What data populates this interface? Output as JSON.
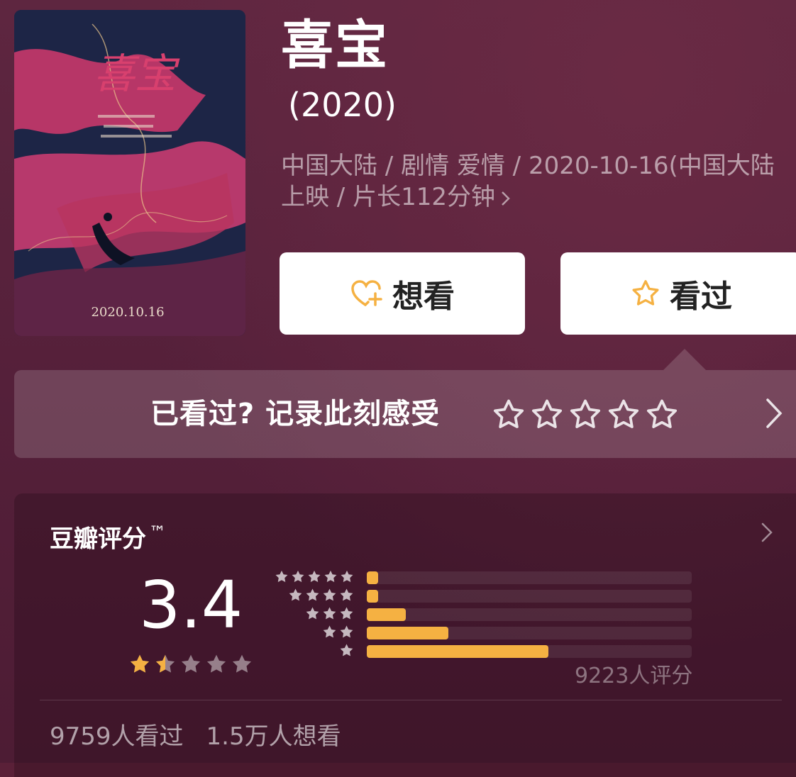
{
  "movie": {
    "title": "喜宝",
    "year": "(2020)",
    "meta_line1": "中国大陆 / 剧情 爱情 / 2020-10-16(中国大陆",
    "meta_line2": "上映 / 片长112分钟",
    "poster": {
      "title_script": "喜宝",
      "date": "2020.10.16"
    }
  },
  "actions": {
    "want_label": "想看",
    "seen_label": "看过",
    "want_icon": "heart-plus-icon",
    "seen_icon": "star-outline-icon"
  },
  "rate_prompt": {
    "text": "已看过? 记录此刻感受",
    "stars": 5
  },
  "rating": {
    "header": "豆瓣评分",
    "trademark": "™",
    "score": "3.4",
    "stars": 1.5,
    "count_text": "9223人评分",
    "distribution": [
      {
        "stars": 5,
        "percent": 3.5
      },
      {
        "stars": 4,
        "percent": 3.5
      },
      {
        "stars": 3,
        "percent": 12
      },
      {
        "stars": 2,
        "percent": 25
      },
      {
        "stars": 1,
        "percent": 56
      }
    ]
  },
  "stats": {
    "watched": "9759人看过",
    "wish": "1.5万人想看"
  },
  "colors": {
    "background": "#5a2038",
    "accent": "#f5b142",
    "button_bg": "#ffffff"
  }
}
